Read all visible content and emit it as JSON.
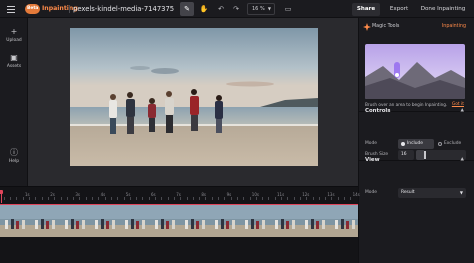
{
  "topbar": {
    "badge": "Beta",
    "mode": "Inpainting",
    "file_name": "pexels-kindel-media-7147375",
    "zoom": "16 %",
    "share": "Share",
    "export": "Export",
    "done": "Done Inpainting"
  },
  "left_rail": {
    "items": [
      {
        "label": "Upload",
        "icon": "plus-icon"
      },
      {
        "label": "Assets",
        "icon": "folder-icon"
      },
      {
        "label": "Help",
        "icon": "help-icon"
      }
    ]
  },
  "panel": {
    "title": "Magic Tools",
    "mode": "Inpainting",
    "hint": "Brush over an area to begin Inpainting.",
    "got_it": "Got it",
    "controls": {
      "title": "Controls",
      "mode_label": "Mode",
      "include": "Include",
      "exclude": "Exclude",
      "brush_size_label": "Brush Size",
      "brush_size": "16",
      "brush_size_fraction": 0.16
    },
    "view": {
      "title": "View",
      "mode_label": "Mode",
      "mode_value": "Result"
    }
  },
  "timeline": {
    "labels": [
      "1s",
      "2s",
      "3s",
      "4s",
      "5s",
      "6s",
      "7s",
      "8s",
      "9s",
      "10s",
      "11s",
      "12s",
      "13s",
      "14s"
    ],
    "playhead_label": "0"
  },
  "colors": {
    "accent": "#ff8b4a",
    "playhead": "#e0455a"
  }
}
